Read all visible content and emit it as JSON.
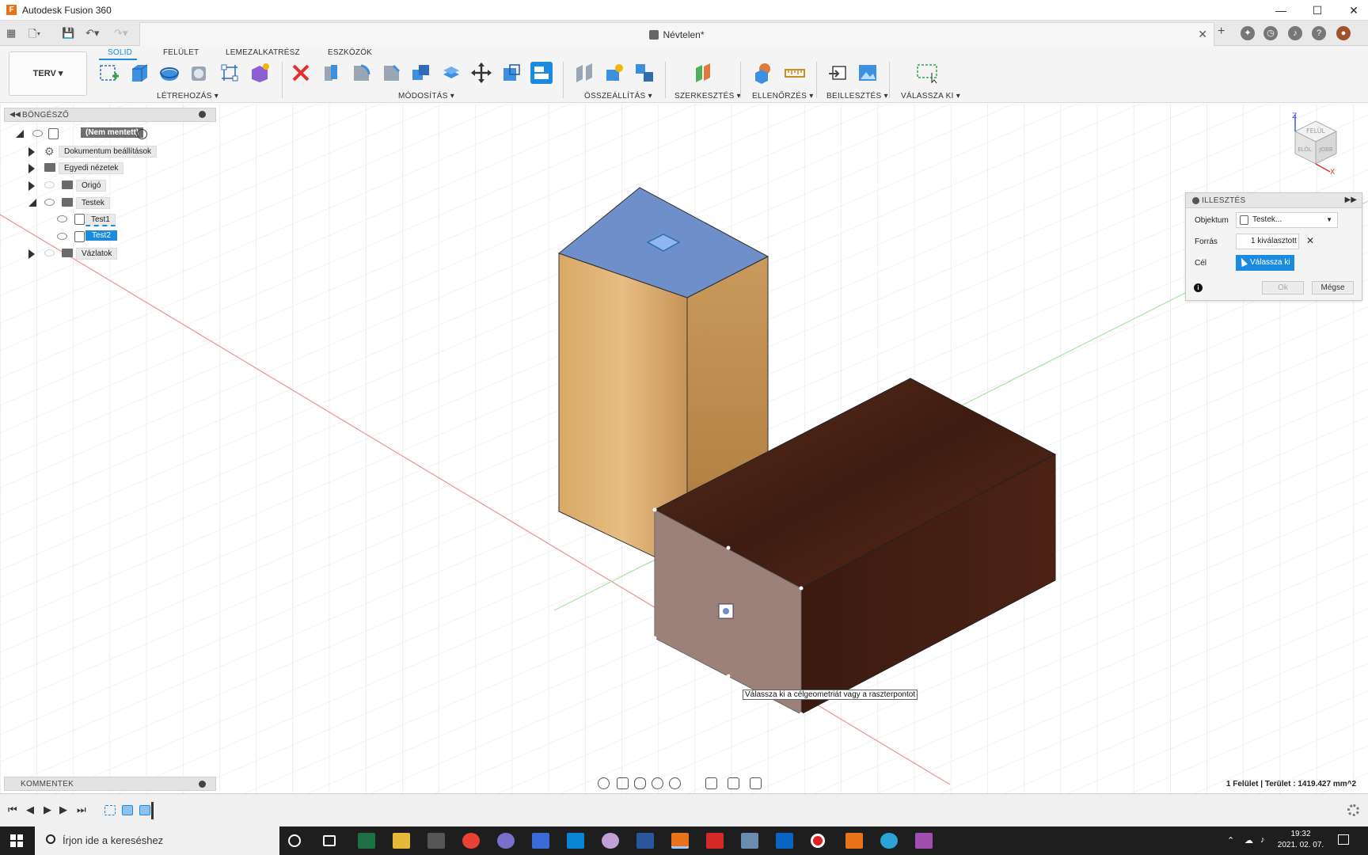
{
  "window": {
    "title": "Autodesk Fusion 360",
    "minimize": "—",
    "maximize": "☐",
    "close": "✕"
  },
  "tabbar": {
    "document_title": "Névtelen*",
    "close": "✕"
  },
  "ribbon": {
    "workspace": "TERV ▾",
    "tabs": [
      "SOLID",
      "FELÜLET",
      "LEMEZALKATRÉSZ",
      "ESZKÖZÖK"
    ],
    "active_tab": "SOLID",
    "groups": [
      "LÉTREHOZÁS ▾",
      "MÓDOSÍTÁS ▾",
      "ÖSSZEÁLLÍTÁS ▾",
      "SZERKESZTÉS ▾",
      "ELLENŐRZÉS ▾",
      "BEILLESZTÉS ▾",
      "VÁLASSZA KI ▾"
    ]
  },
  "browser": {
    "header": "BÖNGÉSZŐ",
    "root": "(Nem mentett)",
    "items": [
      {
        "label": "Dokumentum beállítások"
      },
      {
        "label": "Egyedi nézetek"
      },
      {
        "label": "Origó"
      },
      {
        "label": "Testek"
      },
      {
        "label": "Test1"
      },
      {
        "label": "Test2"
      },
      {
        "label": "Vázlatok"
      }
    ]
  },
  "viewcube": {
    "top": "FELÜL",
    "front": "ELÖL",
    "right": "JOBB",
    "z": "Z",
    "x": "X"
  },
  "align_dialog": {
    "title": "ILLESZTÉS",
    "object_label": "Objektum",
    "object_value": "Testek...",
    "source_label": "Forrás",
    "source_value": "1 kiválasztott",
    "target_label": "Cél",
    "target_value": "Válassza ki",
    "ok": "Ok",
    "cancel": "Mégse"
  },
  "tooltip": "Válassza ki a célgeometriát vagy a raszterpontot",
  "comments": {
    "header": "KOMMENTEK"
  },
  "status": "1 Felület | Terület : 1419.427 mm^2",
  "taskbar": {
    "search_placeholder": "Írjon ide a kereséshez",
    "time": "19:32",
    "date": "2021. 02. 07."
  },
  "colors": {
    "accent": "#1a8be0",
    "selection_face": "#6e8fca",
    "body1_wood": "#d2a56a",
    "body2_wood": "#4a2418"
  }
}
